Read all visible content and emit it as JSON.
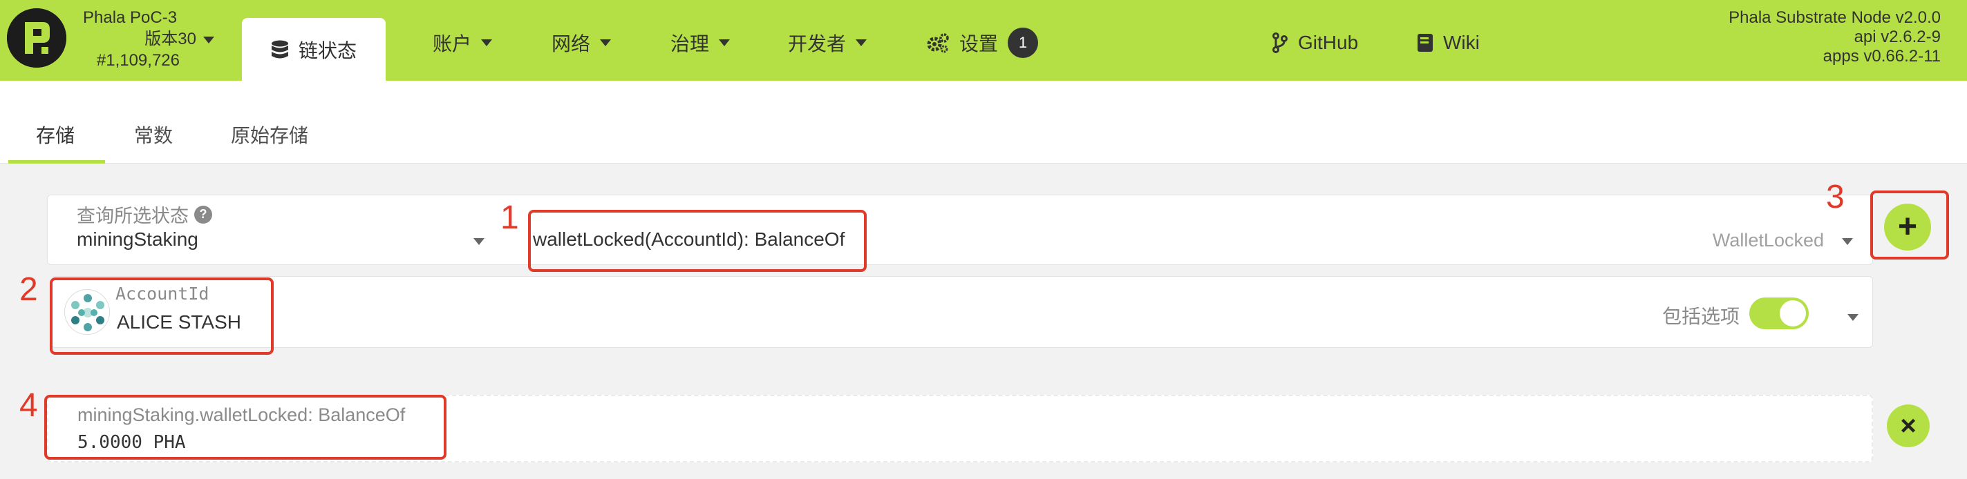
{
  "nav": {
    "chain_name": "Phala PoC-3",
    "version": "版本30",
    "block_number": "#1,109,726",
    "active_tab": "链状态",
    "menu": [
      {
        "label": "账户"
      },
      {
        "label": "网络"
      },
      {
        "label": "治理"
      },
      {
        "label": "开发者"
      }
    ],
    "settings_label": "设置",
    "settings_badge": "1",
    "github_label": "GitHub",
    "wiki_label": "Wiki",
    "node_name": "Phala Substrate Node v2.0.0",
    "api_version": "api v2.6.2-9",
    "apps_version": "apps v0.66.2-11"
  },
  "subtabs": [
    {
      "label": "存储",
      "active": true
    },
    {
      "label": "常数",
      "active": false
    },
    {
      "label": "原始存储",
      "active": false
    }
  ],
  "query": {
    "label": "查询所选状态",
    "help_icon_text": "?",
    "module": "miningStaking",
    "method": "walletLocked(AccountId): BalanceOf",
    "return_type": "WalletLocked",
    "add_symbol": "+"
  },
  "param": {
    "label": "AccountId",
    "value": "ALICE STASH",
    "include_option_label": "包括选项",
    "include_option_enabled": true
  },
  "result": {
    "label": "miningStaking.walletLocked: BalanceOf",
    "value": "5.0000 PHA",
    "close_symbol": "×"
  },
  "annotations": [
    "1",
    "2",
    "3",
    "4"
  ],
  "colors": {
    "accent": "#b5e045",
    "annotation": "#e03a2a",
    "dark": "#1c1c1c"
  },
  "icons": {
    "logo": "phala-logo",
    "chain_state": "database-icon",
    "settings": "gears-icon",
    "github": "code-branch-icon",
    "wiki": "book-icon"
  }
}
